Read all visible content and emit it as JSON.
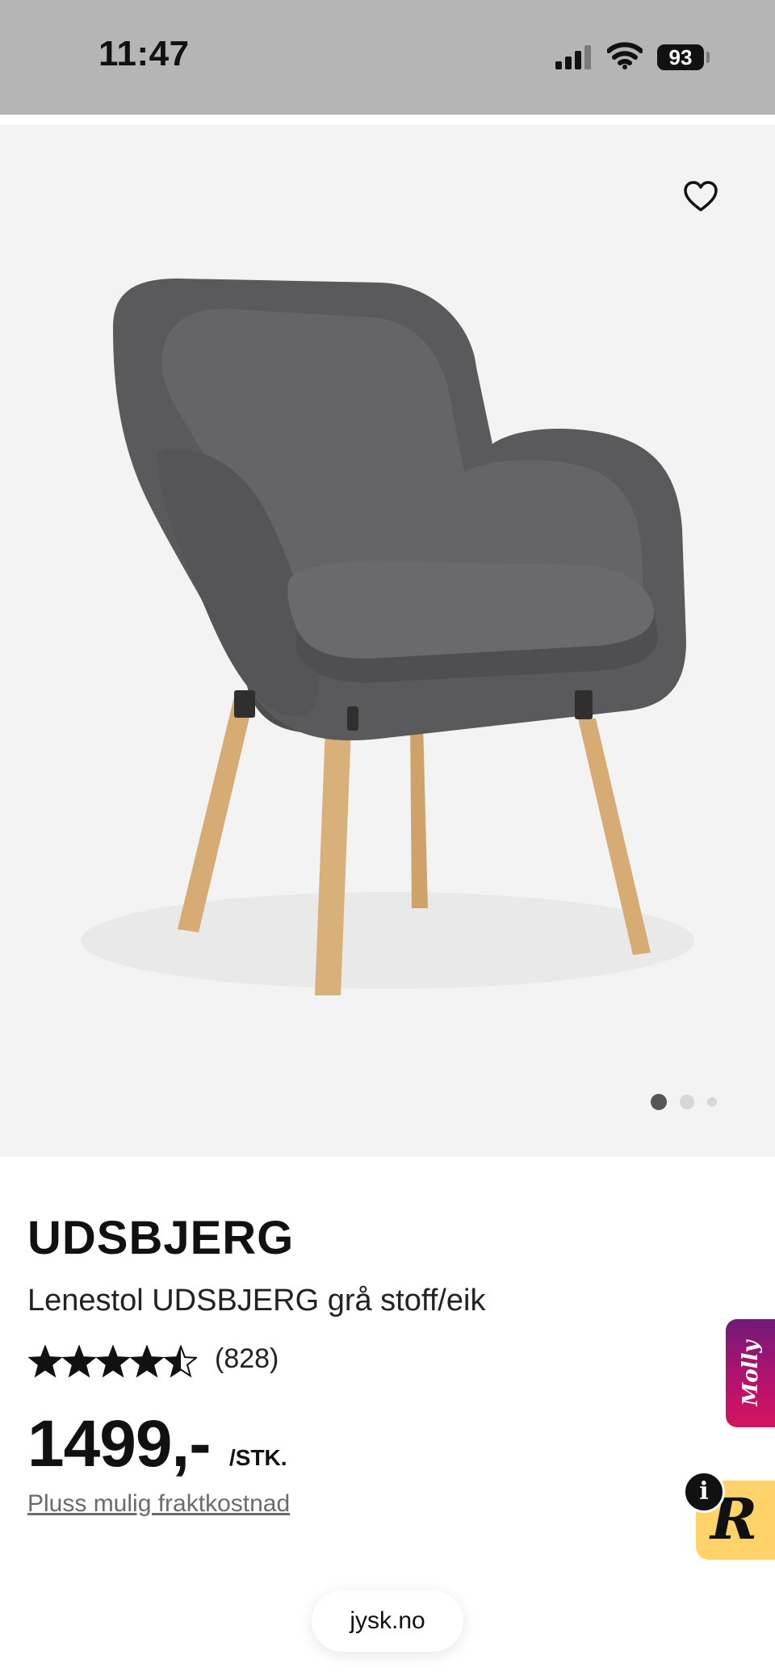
{
  "status_bar": {
    "time": "11:47",
    "battery": "93"
  },
  "product": {
    "brand": "UDSBJERG",
    "name": "Lenestol UDSBJERG grå stoff/eik",
    "rating": 4.5,
    "rating_max": 5,
    "review_count": "(828)",
    "price": "1499,-",
    "unit": "/STK.",
    "shipping_note": "Pluss mulig fraktkostnad",
    "image_index": 1,
    "image_count": 3
  },
  "widgets": {
    "molly_label": "Molly",
    "r_label": "R",
    "info_label": "i"
  },
  "browser": {
    "url": "jysk.no"
  },
  "icons": {
    "favorite": "heart-outline-icon",
    "signal": "cellular-signal-icon",
    "wifi": "wifi-icon",
    "battery": "battery-icon",
    "star": "star-icon"
  },
  "colors": {
    "status_bar_bg": "#b5b5b5",
    "image_bg": "#f3f3f3",
    "upholstery": "#58585a",
    "wood": "#d6ac74",
    "star": "#111111",
    "molly_gradient_start": "#6f1a77",
    "molly_gradient_end": "#d4145f",
    "r_widget_bg": "#ffd369"
  }
}
